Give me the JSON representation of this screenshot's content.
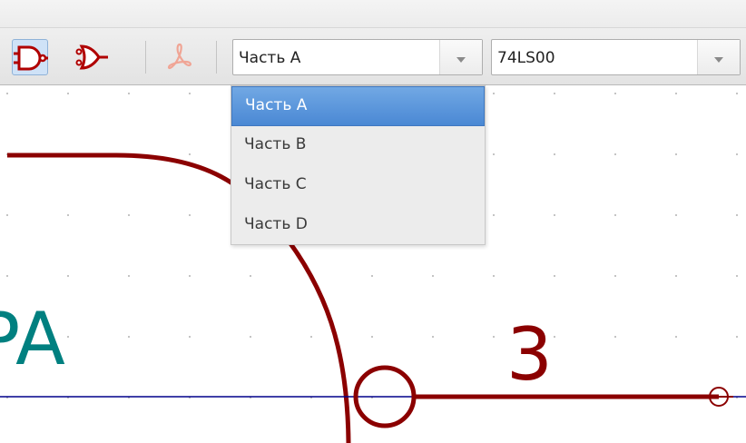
{
  "toolbar": {
    "buttons": [
      {
        "icon": "and-gate-icon",
        "active": true
      },
      {
        "icon": "demorgan-gate-icon",
        "active": false
      },
      {
        "icon": "pdf-icon",
        "active": false
      }
    ],
    "unit_select": {
      "value": "Часть A"
    },
    "part_select": {
      "value": "74LS00"
    }
  },
  "dropdown": {
    "items": [
      "Часть A",
      "Часть B",
      "Часть C",
      "Часть D"
    ],
    "selected_index": 0
  },
  "canvas": {
    "pin_number": "3",
    "ref_fragment": "PA",
    "colors": {
      "symbol": "#8b0000",
      "reference": "#008080",
      "wire": "#00008b",
      "grid": "#9a9a9a"
    }
  }
}
